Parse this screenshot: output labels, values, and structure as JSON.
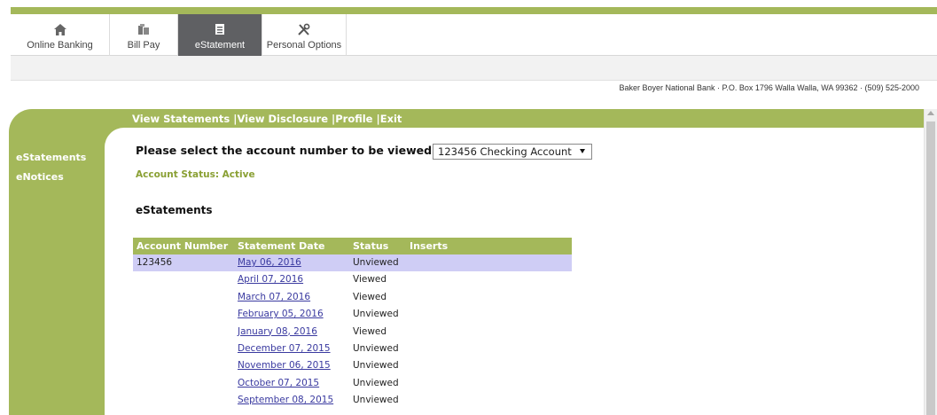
{
  "nav": {
    "tabs": [
      {
        "label": "Online Banking",
        "icon": "home-icon"
      },
      {
        "label": "Bill Pay",
        "icon": "bills-icon"
      },
      {
        "label": "eStatement",
        "icon": "document-icon"
      },
      {
        "label": "Personal Options",
        "icon": "tools-icon"
      }
    ],
    "active_index": 2
  },
  "address": "Baker Boyer National Bank · P.O. Box 1796 Walla Walla, WA 99362 · (509) 525-2000",
  "header_links": {
    "view_statements": "View Statements",
    "view_disclosure": "View Disclosure",
    "profile": "Profile",
    "exit": "Exit",
    "separator": " |"
  },
  "sidebar": {
    "items": [
      {
        "label": "eStatements"
      },
      {
        "label": "eNotices"
      }
    ]
  },
  "main": {
    "prompt": "Please select the account number to be viewed:",
    "account_select_value": "123456 Checking Account",
    "account_status": "Account Status: Active",
    "section_title": "eStatements"
  },
  "table": {
    "columns": [
      "Account Number",
      "Statement Date",
      "Status",
      "Inserts"
    ],
    "rows": [
      {
        "account": "123456",
        "date": "May 06, 2016",
        "status": "Unviewed",
        "inserts": ""
      },
      {
        "account": "",
        "date": "April 07, 2016",
        "status": "Viewed",
        "inserts": ""
      },
      {
        "account": "",
        "date": "March 07, 2016",
        "status": "Viewed",
        "inserts": ""
      },
      {
        "account": "",
        "date": "February 05, 2016",
        "status": "Unviewed",
        "inserts": ""
      },
      {
        "account": "",
        "date": "January 08, 2016",
        "status": "Viewed",
        "inserts": ""
      },
      {
        "account": "",
        "date": "December 07, 2015",
        "status": "Unviewed",
        "inserts": ""
      },
      {
        "account": "",
        "date": "November 06, 2015",
        "status": "Unviewed",
        "inserts": ""
      },
      {
        "account": "",
        "date": "October 07, 2015",
        "status": "Unviewed",
        "inserts": ""
      },
      {
        "account": "",
        "date": "September 08, 2015",
        "status": "Unviewed",
        "inserts": ""
      }
    ],
    "highlight_row": 0
  },
  "colors": {
    "accent_green": "#a4b85a",
    "active_tab": "#5f6063",
    "row_highlight": "#cfcdf5",
    "status_green": "#8aa034",
    "link": "#3a3aa0"
  }
}
